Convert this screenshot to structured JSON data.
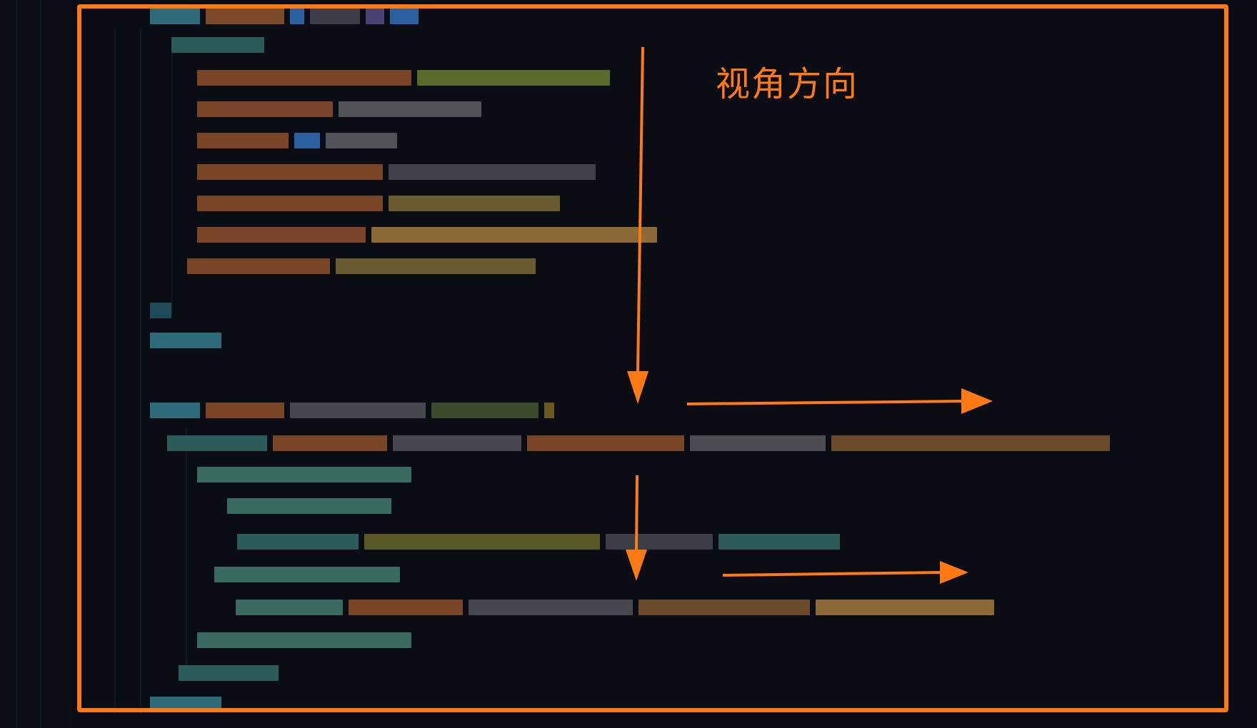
{
  "annotation": {
    "label": "视角方向",
    "accent_color": "#ff7a12"
  },
  "editor": {
    "content_state": "blurred-code",
    "theme": "dark"
  }
}
